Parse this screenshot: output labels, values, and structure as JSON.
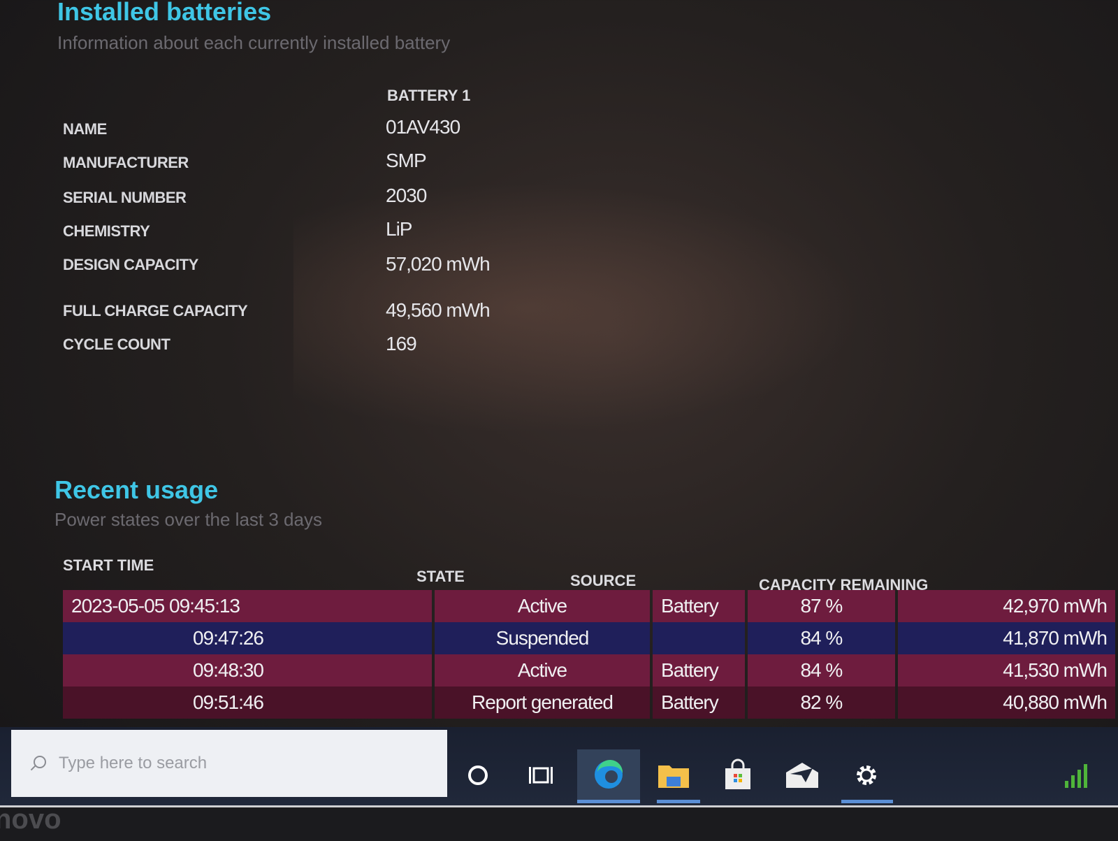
{
  "installed_batteries": {
    "title": "Installed batteries",
    "subtitle": "Information about each currently installed battery",
    "column_header": "BATTERY 1",
    "rows": [
      {
        "label": "NAME",
        "value": "01AV430"
      },
      {
        "label": "MANUFACTURER",
        "value": "SMP"
      },
      {
        "label": "SERIAL NUMBER",
        "value": "2030"
      },
      {
        "label": "CHEMISTRY",
        "value": "LiP"
      },
      {
        "label": "DESIGN CAPACITY",
        "value": "57,020 mWh"
      },
      {
        "label": "FULL CHARGE CAPACITY",
        "value": "49,560 mWh"
      },
      {
        "label": "CYCLE COUNT",
        "value": "169"
      }
    ]
  },
  "recent_usage": {
    "title": "Recent usage",
    "subtitle": "Power states over the last 3 days",
    "headers": {
      "start_time": "START TIME",
      "state": "STATE",
      "source": "SOURCE",
      "capacity_remaining": "CAPACITY REMAINING"
    },
    "rows": [
      {
        "start_time": "2023-05-05  09:45:13",
        "state": "Active",
        "source": "Battery",
        "percent": "87 %",
        "mwh": "42,970 mWh"
      },
      {
        "start_time": "09:47:26",
        "state": "Suspended",
        "source": "",
        "percent": "84 %",
        "mwh": "41,870 mWh"
      },
      {
        "start_time": "09:48:30",
        "state": "Active",
        "source": "Battery",
        "percent": "84 %",
        "mwh": "41,530 mWh"
      },
      {
        "start_time": "09:51:46",
        "state": "Report generated",
        "source": "Battery",
        "percent": "82 %",
        "mwh": "40,880 mWh"
      }
    ]
  },
  "taskbar": {
    "search_placeholder": "Type here to search",
    "icons": [
      "cortana-icon",
      "task-view-icon",
      "edge-icon",
      "file-explorer-icon",
      "store-icon",
      "mail-icon",
      "settings-icon"
    ]
  },
  "bezel": {
    "brand": "novo"
  },
  "colors": {
    "accent": "#3fc6e6",
    "row_active": "#6e1c3e",
    "row_suspended": "#1f1f5a",
    "taskbar_indicator": "#5b8fd6"
  }
}
